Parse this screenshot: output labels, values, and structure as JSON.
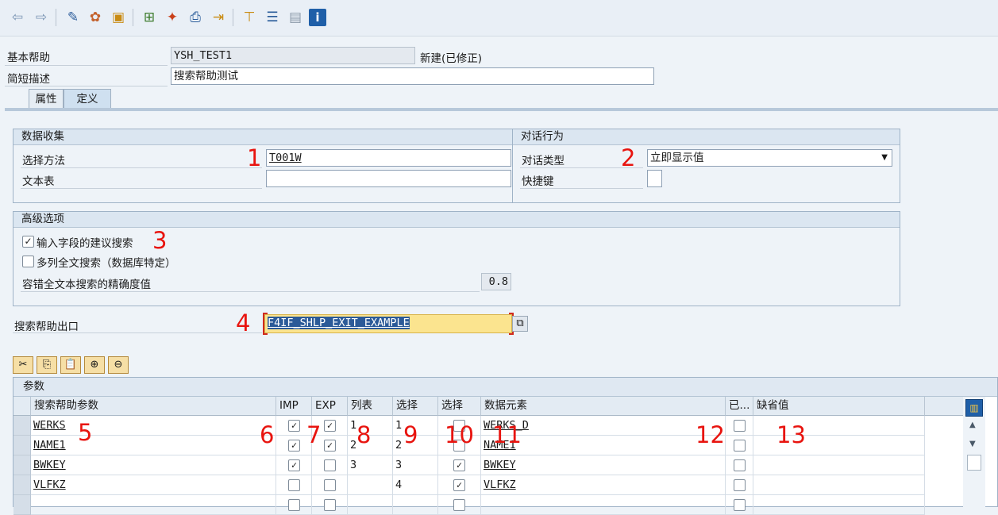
{
  "toolbar": {
    "icons": [
      "back-icon",
      "forward-icon",
      "display-change-icon",
      "activate-icon",
      "where-used-icon",
      "hierarchy-icon",
      "magic-wand-icon",
      "print-icon",
      "transport-icon",
      "structure-icon",
      "list-icon",
      "layout-icon",
      "info-icon"
    ]
  },
  "header": {
    "basic_help_label": "基本帮助",
    "basic_help_value": "YSH_TEST1",
    "status": "新建(已修正)",
    "short_desc_label": "简短描述",
    "short_desc_value": "搜索帮助测试"
  },
  "tabs": [
    {
      "label": "属性"
    },
    {
      "label": "定义"
    }
  ],
  "data_collection": {
    "title": "数据收集",
    "selection_method_label": "选择方法",
    "selection_method_value": "T001W",
    "text_table_label": "文本表",
    "text_table_value": ""
  },
  "dialog_behavior": {
    "title": "对话行为",
    "dialog_type_label": "对话类型",
    "dialog_type_value": "立即显示值",
    "hotkey_label": "快捷键",
    "hotkey_value": ""
  },
  "advanced": {
    "title": "高级选项",
    "suggest_label": "输入字段的建议搜索",
    "suggest_checked": true,
    "multi_col_label": "多列全文搜索（数据库特定）",
    "multi_col_checked": false,
    "fuzzy_label": "容错全文本搜索的精确度值",
    "fuzzy_value": "0.8"
  },
  "exit": {
    "label": "搜索帮助出口",
    "value": "F4IF_SHLP_EXIT_EXAMPLE"
  },
  "annotations": [
    "1",
    "2",
    "3",
    "4",
    "5",
    "6",
    "7",
    "8",
    "9",
    "10",
    "11",
    "12",
    "13"
  ],
  "params": {
    "title": "参数",
    "columns": [
      "搜索帮助参数",
      "IMP",
      "EXP",
      "列表",
      "选择",
      "选择",
      "数据元素",
      "已...",
      "缺省值"
    ],
    "rows": [
      {
        "param": "WERKS",
        "imp": true,
        "exp": true,
        "lpos": "1",
        "spos": "1",
        "sdis": false,
        "element": "WERKS_D",
        "mod": false,
        "default": ""
      },
      {
        "param": "NAME1",
        "imp": true,
        "exp": true,
        "lpos": "2",
        "spos": "2",
        "sdis": false,
        "element": "NAME1",
        "mod": false,
        "default": ""
      },
      {
        "param": "BWKEY",
        "imp": true,
        "exp": false,
        "lpos": "3",
        "spos": "3",
        "sdis": true,
        "element": "BWKEY",
        "mod": false,
        "default": ""
      },
      {
        "param": "VLFKZ",
        "imp": false,
        "exp": false,
        "lpos": "",
        "spos": "4",
        "sdis": true,
        "element": "VLFKZ",
        "mod": false,
        "default": ""
      },
      {
        "param": "",
        "imp": false,
        "exp": false,
        "lpos": "",
        "spos": "",
        "sdis": false,
        "element": "",
        "mod": false,
        "default": ""
      }
    ]
  }
}
